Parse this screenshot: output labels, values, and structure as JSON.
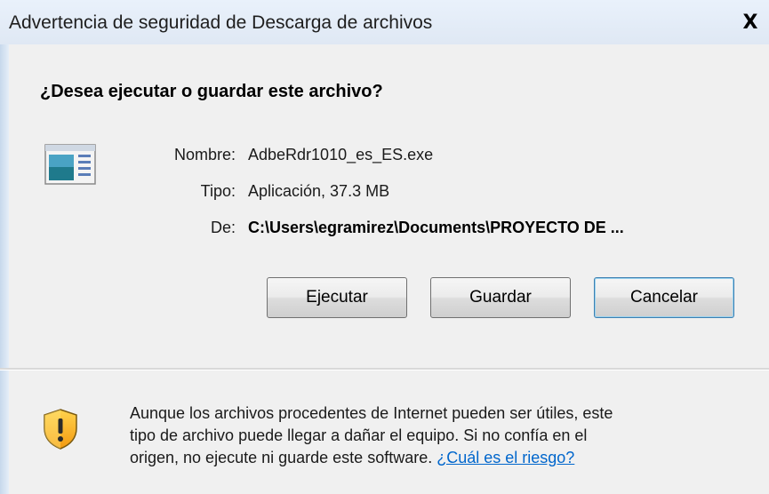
{
  "window": {
    "title": "Advertencia de seguridad de Descarga de archivos",
    "close_label": "X"
  },
  "dialog": {
    "question": "¿Desea ejecutar o guardar este archivo?",
    "file": {
      "name_label": "Nombre:",
      "name_value": "AdbeRdr1010_es_ES.exe",
      "type_label": "Tipo:",
      "type_value": "Aplicación, 37.3 MB",
      "from_label": "De:",
      "from_value": "C:\\Users\\egramirez\\Documents\\PROYECTO DE ..."
    },
    "buttons": {
      "run": "Ejecutar",
      "save": "Guardar",
      "cancel": "Cancelar"
    },
    "warning": {
      "line1": "Aunque los archivos procedentes de Internet pueden ser útiles, este",
      "line2": "tipo de archivo puede llegar a dañar el equipo. Si no confía en el",
      "line3": "origen, no ejecute ni guarde este software.",
      "link": "¿Cuál es el riesgo?"
    }
  },
  "icons": {
    "file": "application-icon",
    "warning": "shield-warning-icon"
  },
  "colors": {
    "link": "#0066cc",
    "title_bg": "#e4edf8",
    "body_bg": "#f0f0f0"
  }
}
